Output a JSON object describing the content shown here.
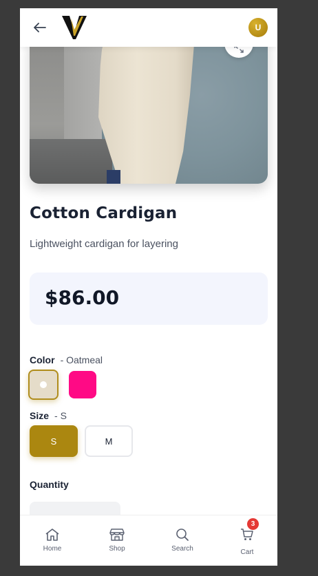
{
  "header": {
    "avatar_initial": "U",
    "brand_colors": {
      "gold": "#c9a227",
      "dark": "#111111"
    }
  },
  "product": {
    "title": "Cotton Cardigan",
    "description": "Lightweight cardigan for layering",
    "price": "$86.00"
  },
  "options": {
    "color_label": "Color",
    "color_selected": "- Oatmeal",
    "colors": [
      {
        "name": "Oatmeal",
        "hex": "#e5dcc9",
        "selected": true
      },
      {
        "name": "Pink",
        "hex": "#ff0a85",
        "selected": false
      }
    ],
    "size_label": "Size",
    "size_selected": "- S",
    "sizes": [
      {
        "label": "S",
        "selected": true
      },
      {
        "label": "M",
        "selected": false
      }
    ],
    "quantity_label": "Quantity"
  },
  "bottom_nav": {
    "items": [
      {
        "label": "Home",
        "icon": "home-icon"
      },
      {
        "label": "Shop",
        "icon": "shop-icon"
      },
      {
        "label": "Search",
        "icon": "search-icon"
      },
      {
        "label": "Cart",
        "icon": "cart-icon"
      }
    ],
    "cart_badge": "3"
  },
  "colors": {
    "accent": "#ab8710",
    "badge": "#e53935",
    "price_bg": "#f3f5fd"
  }
}
